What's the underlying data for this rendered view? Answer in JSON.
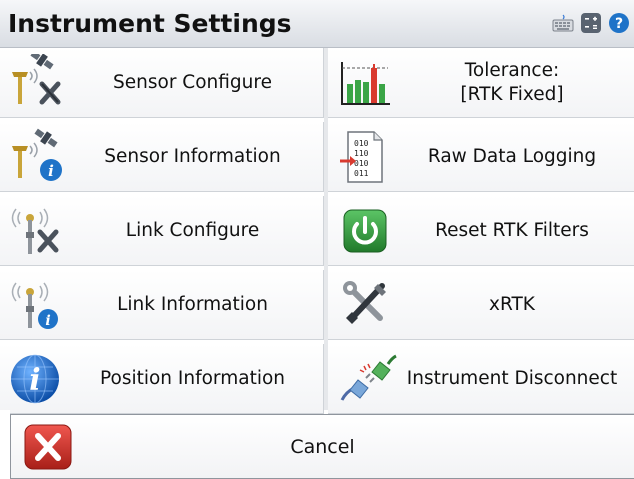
{
  "header": {
    "title": "Instrument Settings"
  },
  "toolbar_icons": [
    "keyboard-icon",
    "calculator-icon",
    "help-icon"
  ],
  "tiles_left": [
    {
      "label": "Sensor Configure",
      "icon": "sensor-configure-icon"
    },
    {
      "label": "Sensor Information",
      "icon": "sensor-information-icon"
    },
    {
      "label": "Link Configure",
      "icon": "link-configure-icon"
    },
    {
      "label": "Link Information",
      "icon": "link-information-icon"
    },
    {
      "label": "Position Information",
      "icon": "position-information-icon"
    }
  ],
  "tiles_right": [
    {
      "label_line1": "Tolerance:",
      "label_line2": "[RTK Fixed]",
      "icon": "tolerance-chart-icon"
    },
    {
      "label": "Raw Data Logging",
      "icon": "raw-data-logging-icon"
    },
    {
      "label": "Reset RTK Filters",
      "icon": "power-reset-icon"
    },
    {
      "label": "xRTK",
      "icon": "tools-icon"
    },
    {
      "label": "Instrument Disconnect",
      "icon": "plug-disconnect-icon"
    }
  ],
  "cancel": {
    "label": "Cancel",
    "icon": "cancel-x-icon"
  },
  "colors": {
    "accent_blue": "#1f73c8",
    "reset_green": "#2f9a3a",
    "cancel_red": "#d9332b",
    "bar_red": "#d93a2f",
    "bar_green": "#3aa546"
  }
}
